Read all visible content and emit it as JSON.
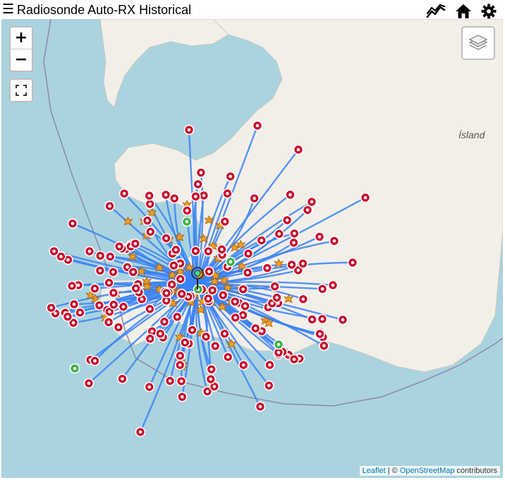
{
  "header": {
    "menu_icon": "☰",
    "title": "Radiosonde Auto-RX Historical",
    "buttons": [
      {
        "name": "chart-icon"
      },
      {
        "name": "home-icon"
      },
      {
        "name": "gear-icon"
      }
    ]
  },
  "map": {
    "zoom_in": "+",
    "zoom_out": "−",
    "country_label": "Ísland",
    "colors": {
      "sea": "#aad3df",
      "land": "#f2efe9",
      "track": "#3b82f6",
      "landing_marker": "#c8102e",
      "active_marker": "#3cb043",
      "burst_marker": "#e8a02a"
    },
    "attribution": {
      "leaflet": "Leaflet",
      "separator": " | © ",
      "osm": "OpenStreetMap",
      "suffix": " contributors"
    }
  }
}
